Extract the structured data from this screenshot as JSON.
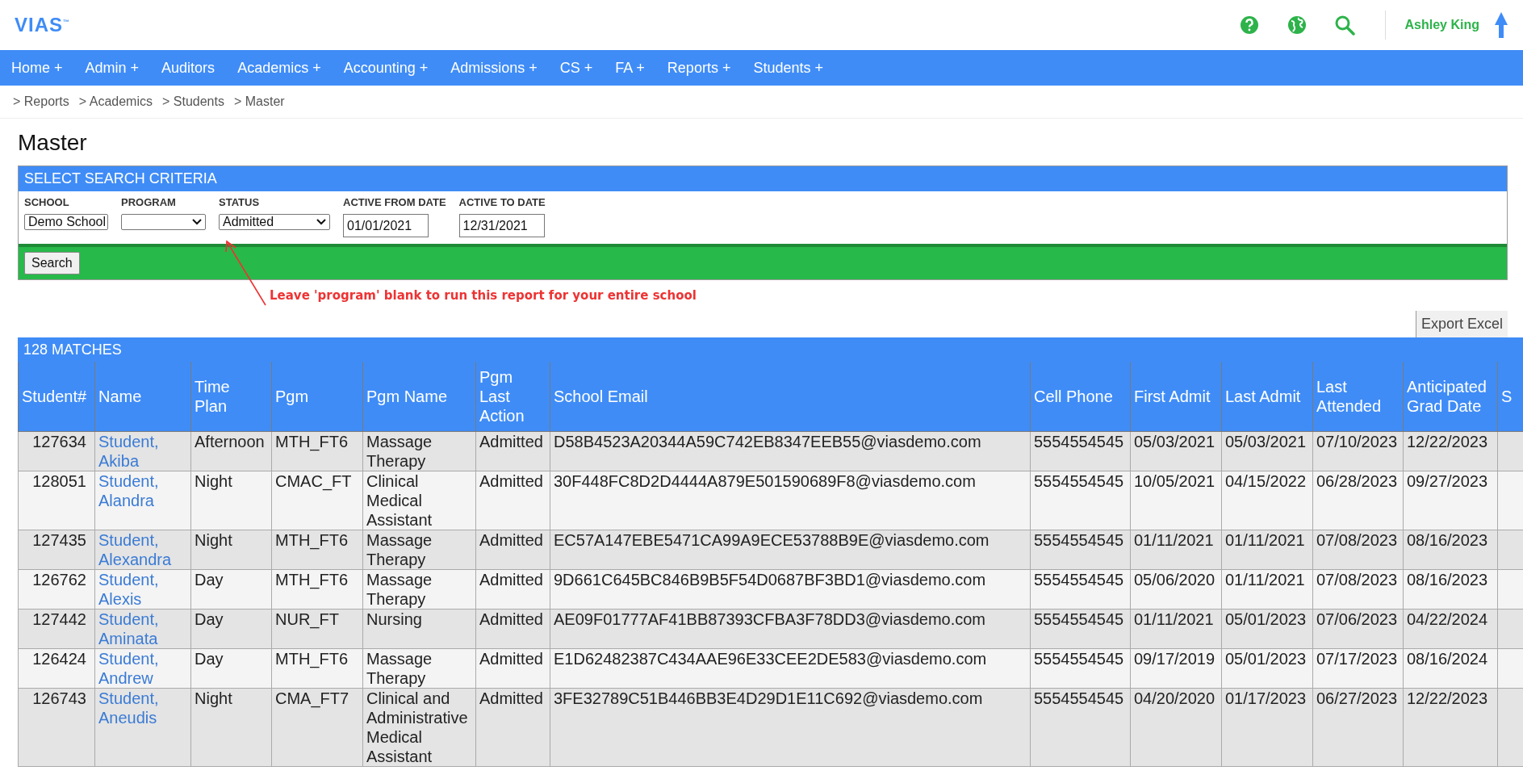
{
  "logo": "VIAS$^{™}$",
  "user": {
    "name": "Ashley King"
  },
  "nav": [
    "Home +",
    "Admin +",
    "Auditors",
    "Academics +",
    "Accounting +",
    "Admissions +",
    "CS +",
    "FA +",
    "Reports +",
    "Students +"
  ],
  "breadcrumb": [
    "> Reports",
    "> Academics",
    "> Students",
    "> Master"
  ],
  "page_title": "Master",
  "criteria": {
    "title": "SELECT SEARCH CRITERIA",
    "fields": [
      {
        "kind": "select",
        "label": "SCHOOL",
        "value": "Demo School"
      },
      {
        "kind": "select",
        "label": "PROGRAM"
      },
      {
        "kind": "select",
        "label": "STATUS",
        "value": "Admitted"
      },
      {
        "kind": "date",
        "label": "ACTIVE FROM DATE",
        "value": "01/01/2021"
      },
      {
        "kind": "date",
        "label": "ACTIVE TO DATE",
        "value": "12/31/2021"
      }
    ],
    "search_button": "Search",
    "annotation": "Leave 'program' blank to run this report for your entire school"
  },
  "export_button": "Export Excel",
  "table": {
    "matches": "128 MATCHES",
    "columns": [
      "Student#",
      "Name",
      "Time\nPlan",
      "Pgm",
      "Pgm Name",
      "Pgm\nLast\nAction",
      "School Email",
      "Cell Phone",
      "First Admit",
      "Last Admit",
      "Last Attended",
      "Anticipated Grad Date",
      "S"
    ],
    "rows": [
      [
        "127634",
        "Student, Akiba",
        "Afternoon",
        "MTH_FT6",
        "Massage Therapy",
        "Admitted",
        "D58B4523A20344A59C742EB8347EEB55@viasdemo.com",
        "5554554545",
        "05/03/2021",
        "05/03/2021",
        "07/10/2023",
        "12/22/2023"
      ],
      [
        "128051",
        "Student, Alandra",
        "Night",
        "CMAC_FT",
        "Clinical Medical Assistant",
        "Admitted",
        "30F448FC8D2D4444A879E501590689F8@viasdemo.com",
        "5554554545",
        "10/05/2021",
        "04/15/2022",
        "06/28/2023",
        "09/27/2023"
      ],
      [
        "127435",
        "Student, Alexandra",
        "Night",
        "MTH_FT6",
        "Massage Therapy",
        "Admitted",
        "EC57A147EBE5471CA99A9ECE53788B9E@viasdemo.com",
        "5554554545",
        "01/11/2021",
        "01/11/2021",
        "07/08/2023",
        "08/16/2023"
      ],
      [
        "126762",
        "Student, Alexis",
        "Day",
        "MTH_FT6",
        "Massage Therapy",
        "Admitted",
        "9D661C645BC846B9B5F54D0687BF3BD1@viasdemo.com",
        "5554554545",
        "05/06/2020",
        "01/11/2021",
        "07/08/2023",
        "08/16/2023"
      ],
      [
        "127442",
        "Student, Aminata",
        "Day",
        "NUR_FT",
        "Nursing",
        "Admitted",
        "AE09F01777AF41BB87393CFBA3F78DD3@viasdemo.com",
        "5554554545",
        "01/11/2021",
        "05/01/2023",
        "07/06/2023",
        "04/22/2024"
      ],
      [
        "126424",
        "Student, Andrew",
        "Day",
        "MTH_FT6",
        "Massage Therapy",
        "Admitted",
        "E1D62482387C434AAE96E33CEE2DE583@viasdemo.com",
        "5554554545",
        "09/17/2019",
        "05/01/2023",
        "07/17/2023",
        "08/16/2024"
      ],
      [
        "126743",
        "Student, Aneudis",
        "Night",
        "CMA_FT7",
        "Clinical and Administrative Medical Assistant",
        "Admitted",
        "3FE32789C51B446BB3E4D29D1E11C692@viasdemo.com",
        "5554554545",
        "04/20/2020",
        "01/17/2023",
        "06/27/2023",
        "12/22/2023"
      ]
    ]
  }
}
